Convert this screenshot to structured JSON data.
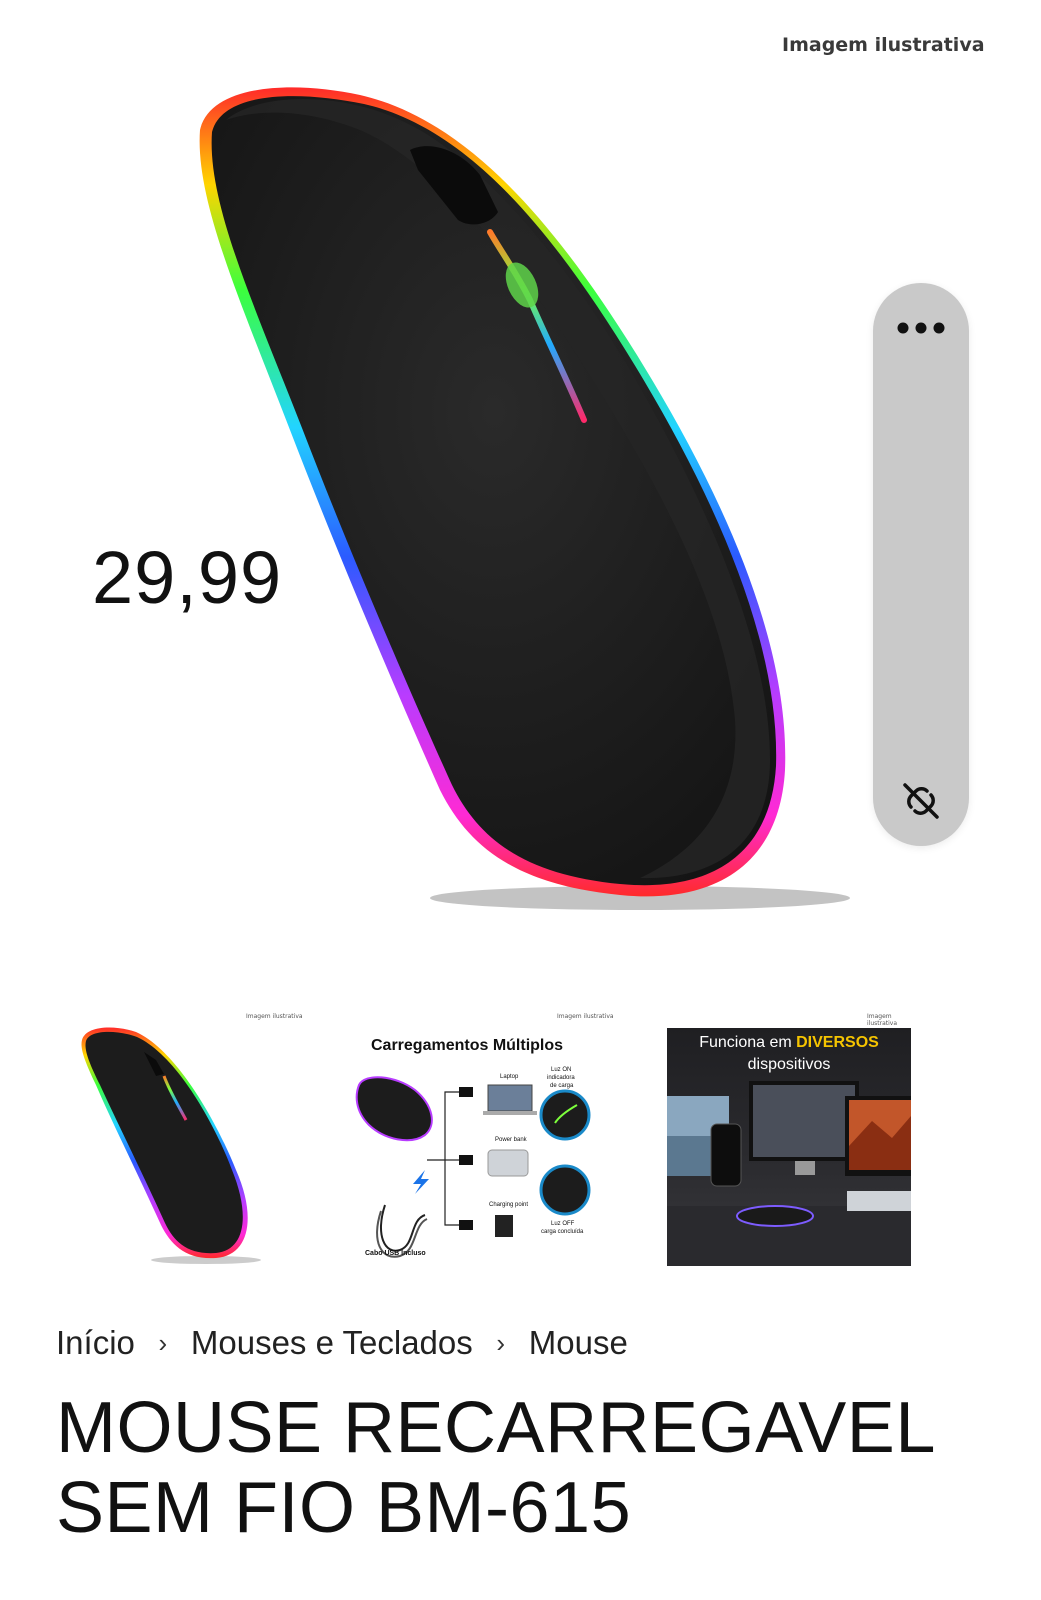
{
  "hero": {
    "watermark": "Imagem ilustrativa",
    "price": "29,99"
  },
  "floating_actions": {
    "more_icon": "more-horizontal-icon",
    "unlink_icon": "unlink-icon"
  },
  "thumbnails": [
    {
      "watermark": "Imagem ilustrativa"
    },
    {
      "watermark": "Imagem ilustrativa",
      "heading": "Carregamentos Múltiplos",
      "laptop": "Laptop",
      "powerbank": "Power bank",
      "charging": "Charging point",
      "luz_on_1": "Luz ON",
      "luz_on_2": "indicadora",
      "luz_on_3": "de carga",
      "luz_off_1": "Luz OFF",
      "luz_off_2": "carga concluída",
      "cable": "Cabo USB Incluso"
    },
    {
      "watermark": "Imagem ilustrativa",
      "line1_a": "Funciona em ",
      "line1_b": "DIVERSOS",
      "line2": "dispositivos"
    }
  ],
  "breadcrumb": {
    "items": [
      "Início",
      "Mouses e Teclados",
      "Mouse"
    ],
    "separator": "›"
  },
  "product": {
    "title_line1": "MOUSE RECARREGAVEL",
    "title_line2": "SEM FIO BM-615"
  },
  "colors": {
    "float_bar": "#c9c9c9",
    "accent_yellow": "#f5c400",
    "mouse_body": "#1c1c1c"
  }
}
